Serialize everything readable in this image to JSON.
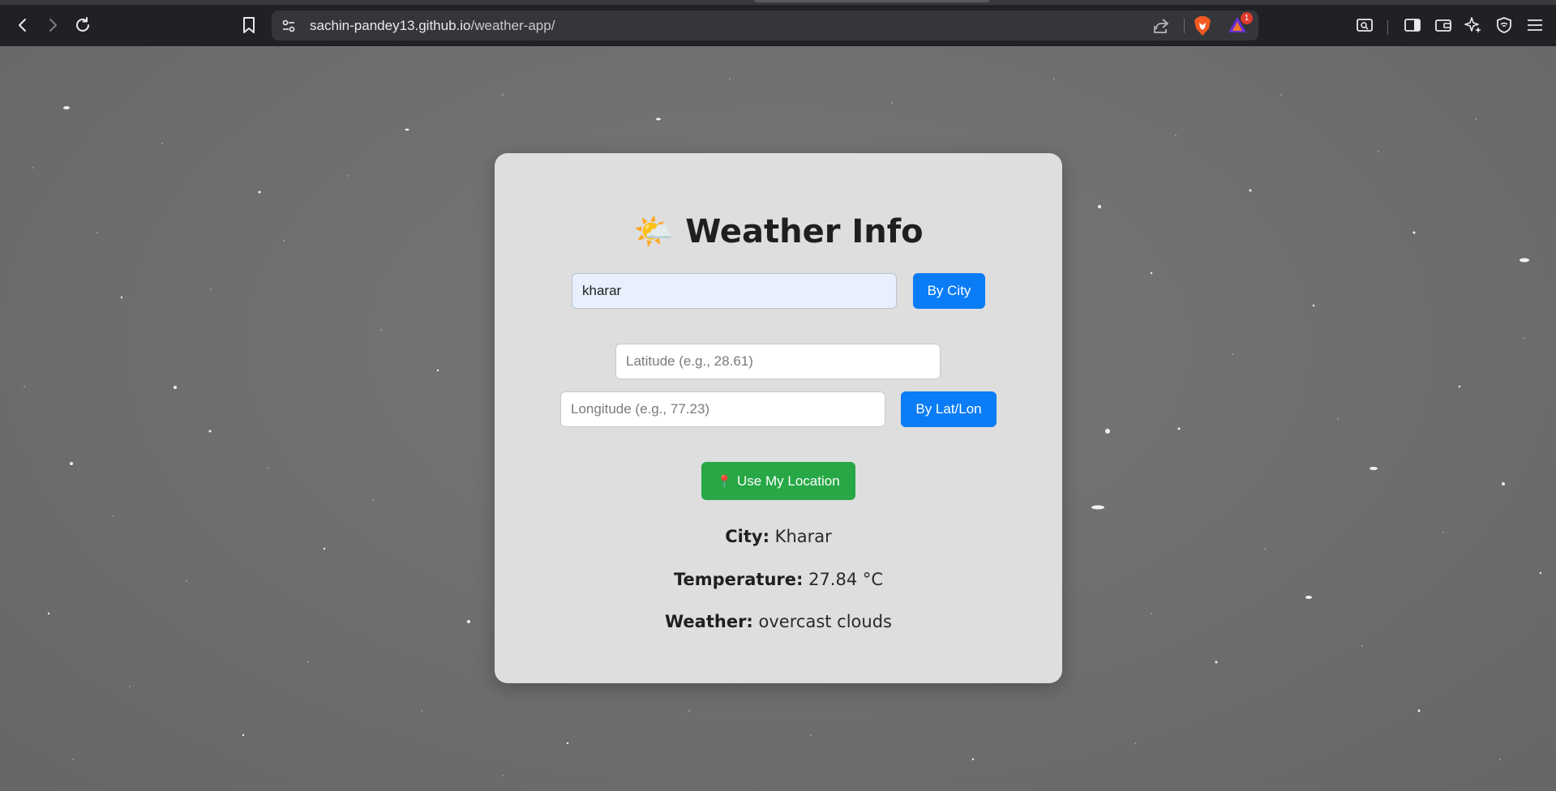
{
  "browser": {
    "url_host": "sachin-pandey13.github.io",
    "url_path": "/weather-app/",
    "rewards_badge": "1"
  },
  "app": {
    "title_emoji": "🌤️",
    "title": "Weather Info",
    "city_input_value": "kharar",
    "by_city_label": "By City",
    "latitude_placeholder": "Latitude (e.g., 28.61)",
    "longitude_placeholder": "Longitude (e.g., 77.23)",
    "by_latlon_label": "By Lat/Lon",
    "location_icon": "📍",
    "use_location_label": "Use My Location",
    "city_label": "City:",
    "city_value": "Kharar",
    "temperature_label": "Temperature:",
    "temperature_value": "27.84 °C",
    "weather_label": "Weather:",
    "weather_value": "overcast clouds"
  }
}
